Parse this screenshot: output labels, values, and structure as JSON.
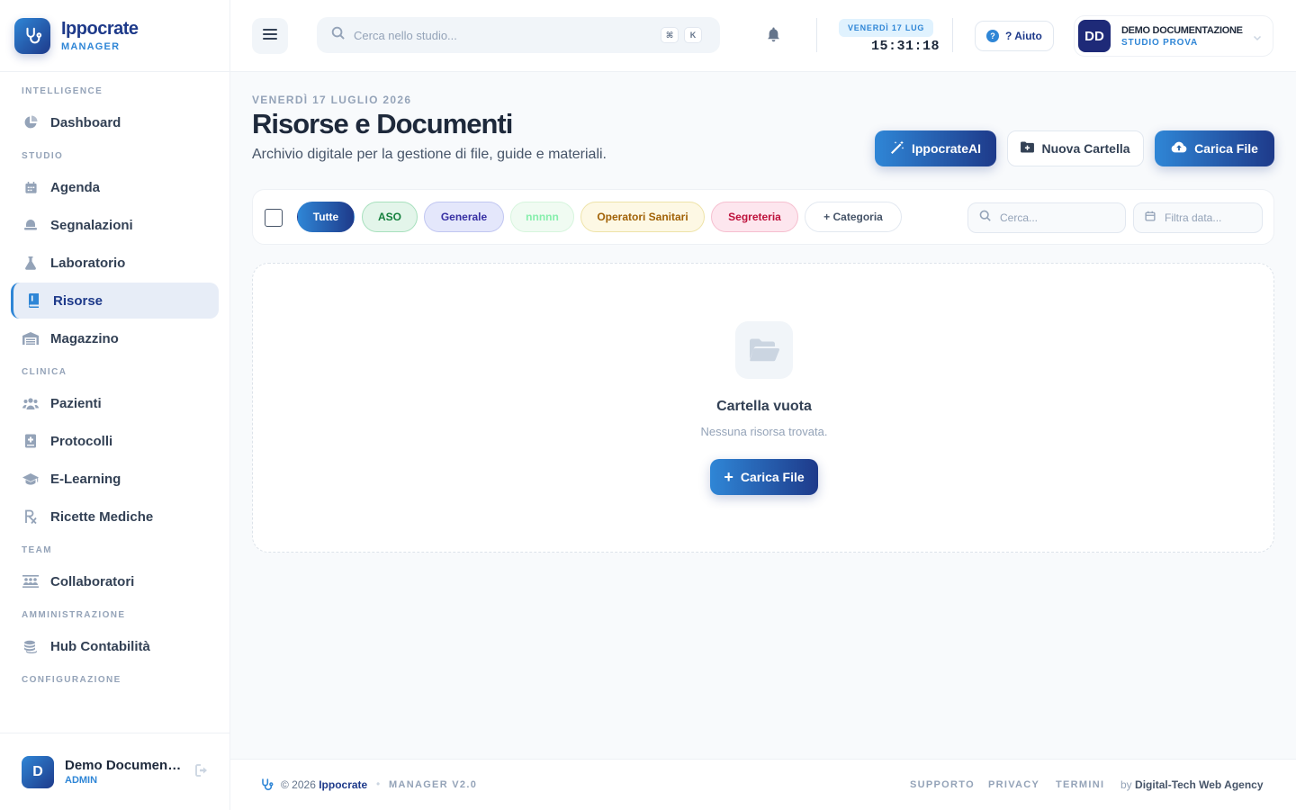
{
  "brand": {
    "name": "Ippocrate",
    "sub": "MANAGER"
  },
  "sidebar": {
    "sections": [
      {
        "title": "INTELLIGENCE",
        "items": [
          {
            "label": "Dashboard",
            "icon": "pie-chart-icon"
          }
        ]
      },
      {
        "title": "STUDIO",
        "items": [
          {
            "label": "Agenda",
            "icon": "calendar-icon"
          },
          {
            "label": "Segnalazioni",
            "icon": "bell-alert-icon"
          },
          {
            "label": "Laboratorio",
            "icon": "flask-icon"
          },
          {
            "label": "Risorse",
            "icon": "book-icon",
            "active": true
          },
          {
            "label": "Magazzino",
            "icon": "warehouse-icon"
          }
        ]
      },
      {
        "title": "CLINICA",
        "items": [
          {
            "label": "Pazienti",
            "icon": "users-icon"
          },
          {
            "label": "Protocolli",
            "icon": "medical-book-icon"
          },
          {
            "label": "E-Learning",
            "icon": "graduation-cap-icon"
          },
          {
            "label": "Ricette Mediche",
            "icon": "prescription-icon"
          }
        ]
      },
      {
        "title": "TEAM",
        "items": [
          {
            "label": "Collaboratori",
            "icon": "team-icon"
          }
        ]
      },
      {
        "title": "AMMINISTRAZIONE",
        "items": [
          {
            "label": "Hub Contabilità",
            "icon": "coins-icon"
          }
        ]
      },
      {
        "title": "CONFIGURAZIONE",
        "items": []
      }
    ],
    "user": {
      "initial": "D",
      "name": "Demo Documentazione",
      "role": "ADMIN"
    }
  },
  "topbar": {
    "search_placeholder": "Cerca nello studio...",
    "kbd": [
      "⌘",
      "K"
    ],
    "date": "VENERDÌ 17 LUG",
    "time": "15:31:18",
    "help": "? Aiuto",
    "studio": {
      "initials": "DD",
      "name": "DEMO DOCUMENTAZIONE",
      "sub": "STUDIO PROVA"
    }
  },
  "header": {
    "date": "VENERDÌ 17 LUGLIO 2026",
    "title": "Risorse e Documenti",
    "subtitle": "Archivio digitale per la gestione di file, guide e materiali.",
    "btn_ai": "IppocrateAI",
    "btn_folder": "Nuova Cartella",
    "btn_upload": "Carica File"
  },
  "filters": {
    "chips": [
      {
        "label": "Tutte",
        "bg": "linear-gradient(90deg,#2f86d6,#1e3a8a)",
        "fg": "#ffffff",
        "border": "transparent"
      },
      {
        "label": "ASO",
        "bg": "#e3f5ea",
        "fg": "#15803d",
        "border": "#a7e0bd"
      },
      {
        "label": "Generale",
        "bg": "#e4e7fb",
        "fg": "#3730a3",
        "border": "#c0c6f1"
      },
      {
        "label": "nnnnn",
        "bg": "#f0fbf2",
        "fg": "#86efac",
        "border": "#d6f5dd"
      },
      {
        "label": "Operatori Sanitari",
        "bg": "#fdf8e4",
        "fg": "#a16207",
        "border": "#eee3a8"
      },
      {
        "label": "Segreteria",
        "bg": "#fde6ee",
        "fg": "#be123c",
        "border": "#f6bfcf"
      },
      {
        "label": "+ Categoria",
        "bg": "#ffffff",
        "fg": "#475569",
        "border": "#e2e8f0"
      }
    ],
    "search_placeholder": "Cerca...",
    "date_placeholder": "Filtra data..."
  },
  "empty": {
    "title": "Cartella vuota",
    "subtitle": "Nessuna risorsa trovata.",
    "button": "Carica File"
  },
  "footer": {
    "year": "© 2026",
    "brand": "Ippocrate",
    "version": "MANAGER V2.0",
    "links": [
      "SUPPORTO",
      "PRIVACY",
      "TERMINI"
    ],
    "by": "by",
    "agency": "Digital-Tech Web Agency"
  }
}
